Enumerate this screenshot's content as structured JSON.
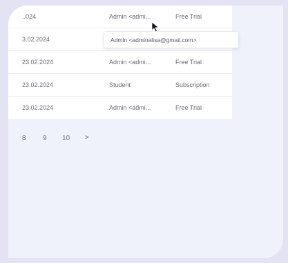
{
  "table": {
    "rows": [
      {
        "date": "..024",
        "role": "Admin <admi...",
        "plan": "Free Trial"
      },
      {
        "date": "3.02.2024",
        "role": "",
        "plan": ""
      },
      {
        "date": "23.02.2024",
        "role": "Admin <admi...",
        "plan": "Free Trial"
      },
      {
        "date": "23.02.2024",
        "role": "Student",
        "plan": "Subscription"
      },
      {
        "date": "23.02.2024",
        "role": "Admin <admi...",
        "plan": "Free Trial"
      }
    ]
  },
  "tooltip": {
    "text": "Admin <adminalisa@gmail.com>"
  },
  "pagination": {
    "pages": [
      "8",
      "9",
      "10"
    ],
    "next": ">"
  },
  "colors": {
    "background": "#e4e3f3",
    "panel": "#eff2fa",
    "text": "#6a6d78"
  }
}
